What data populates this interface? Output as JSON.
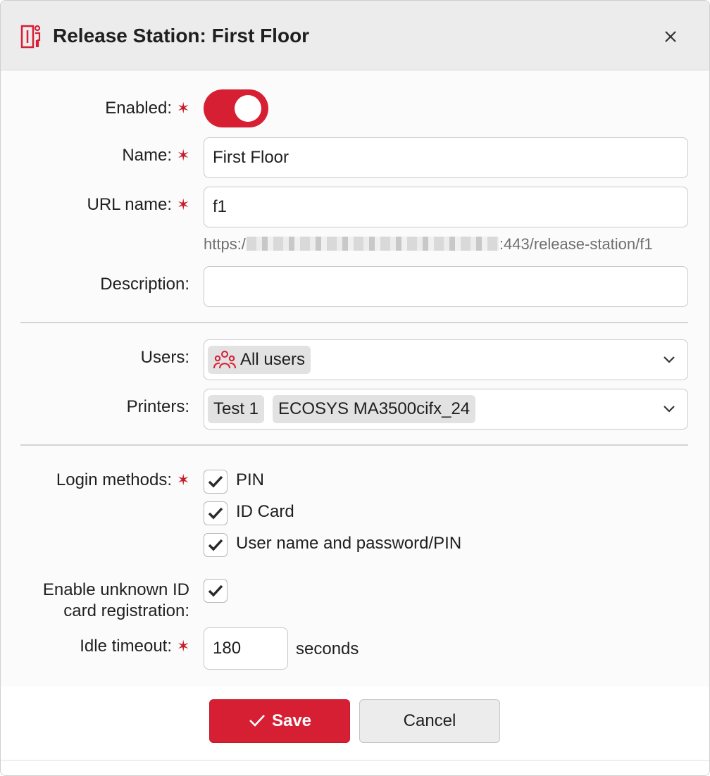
{
  "dialog": {
    "title": "Release Station: First Floor",
    "title_icon": "release-station-icon",
    "close_icon": "close-icon"
  },
  "form": {
    "enabled": {
      "label": "Enabled:",
      "required": "✶",
      "value": true
    },
    "name": {
      "label": "Name:",
      "required": "✶",
      "value": "First Floor"
    },
    "url_name": {
      "label": "URL name:",
      "required": "✶",
      "value": "f1",
      "hint_prefix": "https:/",
      "hint_suffix": ":443/release-station/f1"
    },
    "description": {
      "label": "Description:",
      "value": ""
    },
    "users": {
      "label": "Users:",
      "chips": [
        "All users"
      ],
      "chip_icon": "users-group-icon"
    },
    "printers": {
      "label": "Printers:",
      "chips": [
        "Test 1",
        "ECOSYS MA3500cifx_24"
      ]
    },
    "login_methods": {
      "label": "Login methods:",
      "required": "✶",
      "options": [
        {
          "label": "PIN",
          "checked": true
        },
        {
          "label": "ID Card",
          "checked": true
        },
        {
          "label": "User name and password/PIN",
          "checked": true
        }
      ]
    },
    "unknown_card": {
      "label_line1": "Enable unknown ID",
      "label_line2": "card registration:",
      "checked": true
    },
    "idle_timeout": {
      "label": "Idle timeout:",
      "required": "✶",
      "value": "180",
      "units": "seconds"
    }
  },
  "footer": {
    "save_label": "Save",
    "cancel_label": "Cancel"
  },
  "colors": {
    "accent": "#d61f33",
    "required": "#c41e2b",
    "header_bg": "#ececec"
  }
}
